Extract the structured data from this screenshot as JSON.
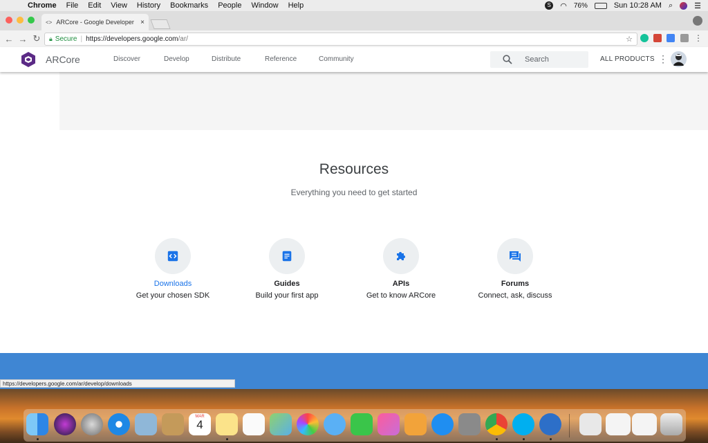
{
  "menubar": {
    "items": [
      "Chrome",
      "File",
      "Edit",
      "View",
      "History",
      "Bookmarks",
      "People",
      "Window",
      "Help"
    ],
    "battery": "76%",
    "clock": "Sun 10:28 AM"
  },
  "browser": {
    "tab_title": "ARCore - Google Developer",
    "secure_label": "Secure",
    "url_host": "https://developers.google.com",
    "url_path": "/ar/",
    "status_url": "https://developers.google.com/ar/develop/downloads"
  },
  "site": {
    "brand": "ARCore",
    "nav": [
      "Discover",
      "Develop",
      "Distribute",
      "Reference",
      "Community"
    ],
    "search_placeholder": "Search",
    "all_products": "ALL PRODUCTS"
  },
  "resources": {
    "title": "Resources",
    "subtitle": "Everything you need to get started",
    "cards": [
      {
        "name": "Downloads",
        "desc": "Get your chosen SDK",
        "icon": "code-icon"
      },
      {
        "name": "Guides",
        "desc": "Build your first app",
        "icon": "document-icon"
      },
      {
        "name": "APIs",
        "desc": "Get to know ARCore",
        "icon": "puzzle-icon"
      },
      {
        "name": "Forums",
        "desc": "Connect, ask, discuss",
        "icon": "chat-icon"
      }
    ]
  },
  "colors": {
    "accent": "#1a73e8",
    "blue_band": "#3f86d3",
    "brand_purple": "#5b2a86"
  },
  "dock": {
    "calendar_month": "MAR",
    "calendar_day": "4"
  }
}
